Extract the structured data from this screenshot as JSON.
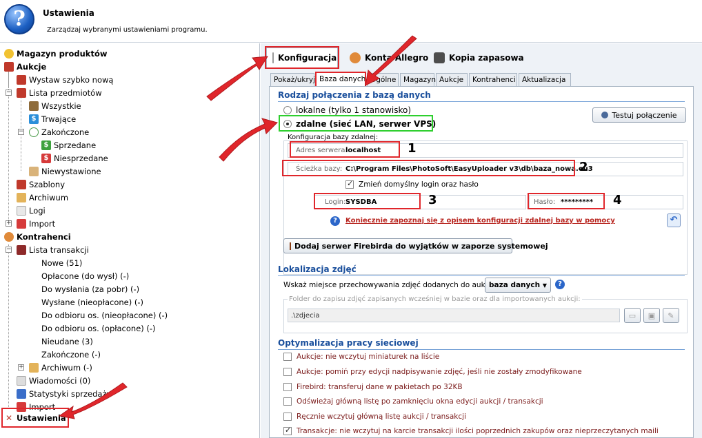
{
  "header": {
    "title": "Ustawienia",
    "subtitle": "Zarządzaj wybranymi ustawieniami programu."
  },
  "sidebar": {
    "magazyn": "Magazyn produktów",
    "aukcje": "Aukcje",
    "wystaw": "Wystaw szybko nową",
    "lista_przedmiotow": "Lista przedmiotów",
    "wszystkie": "Wszystkie",
    "trwajace": "Trwające",
    "zakonczone": "Zakończone",
    "sprzedane": "Sprzedane",
    "niesprzedane": "Niesprzedane",
    "niewystawione": "Niewystawione",
    "szablony": "Szablony",
    "archiwum": "Archiwum",
    "logi": "Logi",
    "import": "Import",
    "kontrahenci": "Kontrahenci",
    "lista_transakcji": "Lista transakcji",
    "nowe": "Nowe (51)",
    "oplacone": "Opłacone (do wysł) (-)",
    "do_wyslania": "Do wysłania (za pobr) (-)",
    "wyslane": "Wysłane (nieopłacone) (-)",
    "odbior_nieopl": "Do odbioru os. (nieopłacone) (-)",
    "odbior_opl": "Do odbioru os. (opłacone) (-)",
    "nieudane": "Nieudane (3)",
    "zakonczone2": "Zakończone (-)",
    "archiwum2": "Archiwum (-)",
    "wiadomosci": "Wiadomości (0)",
    "statystyki": "Statystyki sprzedaży",
    "import2": "Import",
    "ustawienia": "Ustawienia"
  },
  "toptabs": {
    "konfiguracja": "Konfiguracja",
    "konta": "Konta Allegro",
    "kopia": "Kopia zapasowa"
  },
  "subtabs": [
    "Pokaż/ukryj",
    "Baza danych",
    "Ogólne",
    "Magazyn",
    "Aukcje",
    "Kontrahenci",
    "Aktualizacja"
  ],
  "db": {
    "section": "Rodzaj połączenia z bazą danych",
    "radio_local": "lokalne (tylko 1 stanowisko)",
    "radio_remote": "zdalne (sieć LAN, serwer VPS)",
    "test_btn": "Testuj połączenie",
    "group": "Konfiguracja bazy zdalnej:",
    "server_label": "Adres serwera:",
    "server_value": "localhost",
    "path_label": "Ścieżka bazy:",
    "path_value": "C:\\Program Files\\PhotoSoft\\EasyUploader v3\\db\\baza_nowa.eu3",
    "change_login": "Zmień domyślny login oraz hasło",
    "login_label": "Login:",
    "login_value": "SYSDBA",
    "pass_label": "Hasło:",
    "pass_value": "*********",
    "help_link": "Koniecznie zapoznaj się z opisem konfiguracji zdalnej bazy w pomocy",
    "firebird_btn": "Dodaj serwer Firebirda do wyjątków w zaporze systemowej"
  },
  "photos": {
    "section": "Lokalizacja zdjęć",
    "label": "Wskaż miejsce przechowywania zdjęć dodanych do aukcji:",
    "select": "baza danych",
    "folder_label": "Folder do zapisu zdjęć zapisanych wcześniej w bazie oraz dla importowanych aukcji:",
    "folder_value": ".\\zdjecia"
  },
  "network": {
    "section": "Optymalizacja pracy sieciowej",
    "options": [
      {
        "label": "Aukcje: nie wczytuj miniaturek na liście",
        "checked": false
      },
      {
        "label": "Aukcje: pomiń przy edycji nadpisywanie zdjęć, jeśli nie zostały zmodyfikowane",
        "checked": false
      },
      {
        "label": "Firebird: transferuj dane w pakietach po 32KB",
        "checked": false
      },
      {
        "label": "Odświeżaj główną listę po zamknięciu okna edycji aukcji / transakcji",
        "checked": false
      },
      {
        "label": "Ręcznie wczytuj główną listę aukcji / transakcji",
        "checked": false
      },
      {
        "label": "Transakcje: nie wczytuj na karcie transakcji ilości poprzednich zakupów oraz nieprzeczytanych maili",
        "checked": true
      }
    ]
  },
  "annotations": {
    "n1": "1",
    "n2": "2",
    "n3": "3",
    "n4": "4"
  },
  "colors": {
    "accent": "#1a4f9c",
    "annotation_red": "#e0262b",
    "annotation_green": "#2ecf2e"
  }
}
